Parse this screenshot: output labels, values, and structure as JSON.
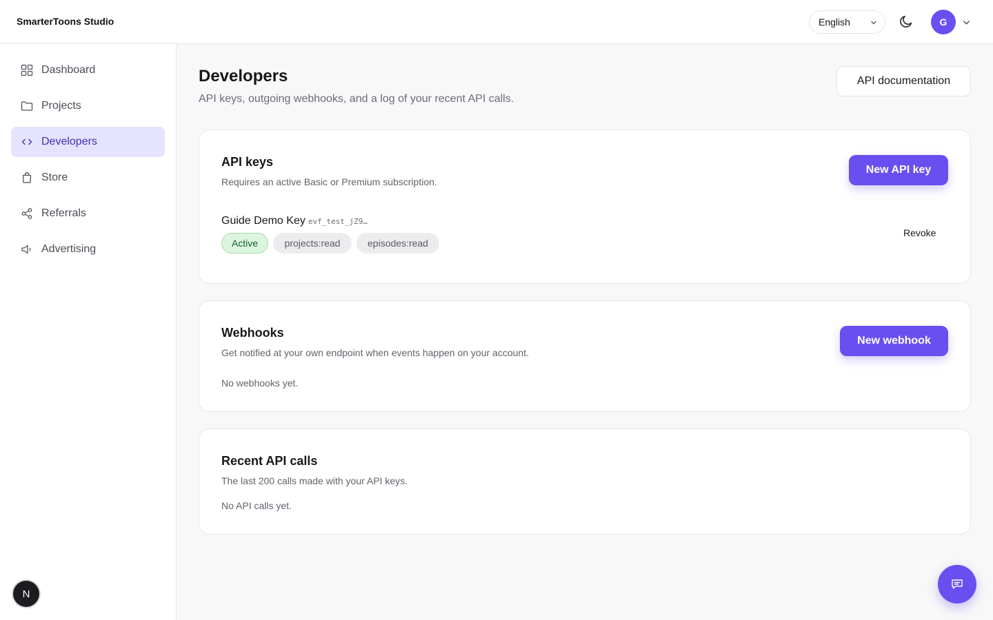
{
  "header": {
    "brand": "SmarterToons Studio",
    "language": "English",
    "avatar_initial": "G",
    "icons": [
      "chevron-down-icon",
      "moon-icon"
    ]
  },
  "sidebar": {
    "items": [
      {
        "label": "Dashboard",
        "icon": "grid-icon",
        "active": false
      },
      {
        "label": "Projects",
        "icon": "folder-icon",
        "active": false
      },
      {
        "label": "Developers",
        "icon": "code-icon",
        "active": true
      },
      {
        "label": "Store",
        "icon": "shopping-bag-icon",
        "active": false
      },
      {
        "label": "Referrals",
        "icon": "share-icon",
        "active": false
      },
      {
        "label": "Advertising",
        "icon": "megaphone-icon",
        "active": false
      }
    ],
    "badge": "N"
  },
  "page": {
    "title": "Developers",
    "subtitle": "API keys, outgoing webhooks, and a log of your recent API calls.",
    "doc_button": "API documentation"
  },
  "api_keys": {
    "title": "API keys",
    "description": "Requires an active Basic or Premium subscription.",
    "new_button": "New API key",
    "keys": [
      {
        "name": "Guide Demo Key",
        "prefix": "evf_test_jZ9…",
        "status": "Active",
        "scopes": [
          "projects:read",
          "episodes:read"
        ],
        "action": "Revoke"
      }
    ]
  },
  "webhooks": {
    "title": "Webhooks",
    "description": "Get notified at your own endpoint when events happen on your account.",
    "new_button": "New webhook",
    "empty": "No webhooks yet."
  },
  "recent_calls": {
    "title": "Recent API calls",
    "description": "The last 200 calls made with your API keys.",
    "empty": "No API calls yet."
  },
  "colors": {
    "accent": "#6a4ff0",
    "active_nav_bg": "#e5e3fd",
    "active_pill_bg": "#dcf5df"
  }
}
